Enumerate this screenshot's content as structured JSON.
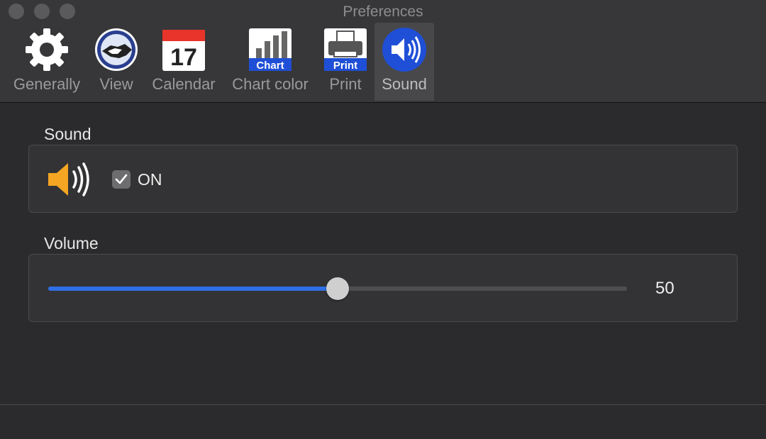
{
  "window": {
    "title": "Preferences"
  },
  "tabs": [
    {
      "label": "Generally",
      "icon": "gear-icon"
    },
    {
      "label": "View",
      "icon": "handshake-icon"
    },
    {
      "label": "Calendar",
      "icon": "calendar-icon",
      "day": "17"
    },
    {
      "label": "Chart color",
      "icon": "chart-icon",
      "badge": "Chart"
    },
    {
      "label": "Print",
      "icon": "printer-icon",
      "badge": "Print"
    },
    {
      "label": "Sound",
      "icon": "speaker-icon",
      "active": true
    }
  ],
  "sound": {
    "section_label": "Sound",
    "checkbox_label": "ON",
    "checked": true
  },
  "volume": {
    "section_label": "Volume",
    "value": "50",
    "fraction": 0.5
  },
  "colors": {
    "accent": "#2f6fe6",
    "speaker": "#f5a623",
    "sound_tab_icon": "#1f4fd6"
  }
}
